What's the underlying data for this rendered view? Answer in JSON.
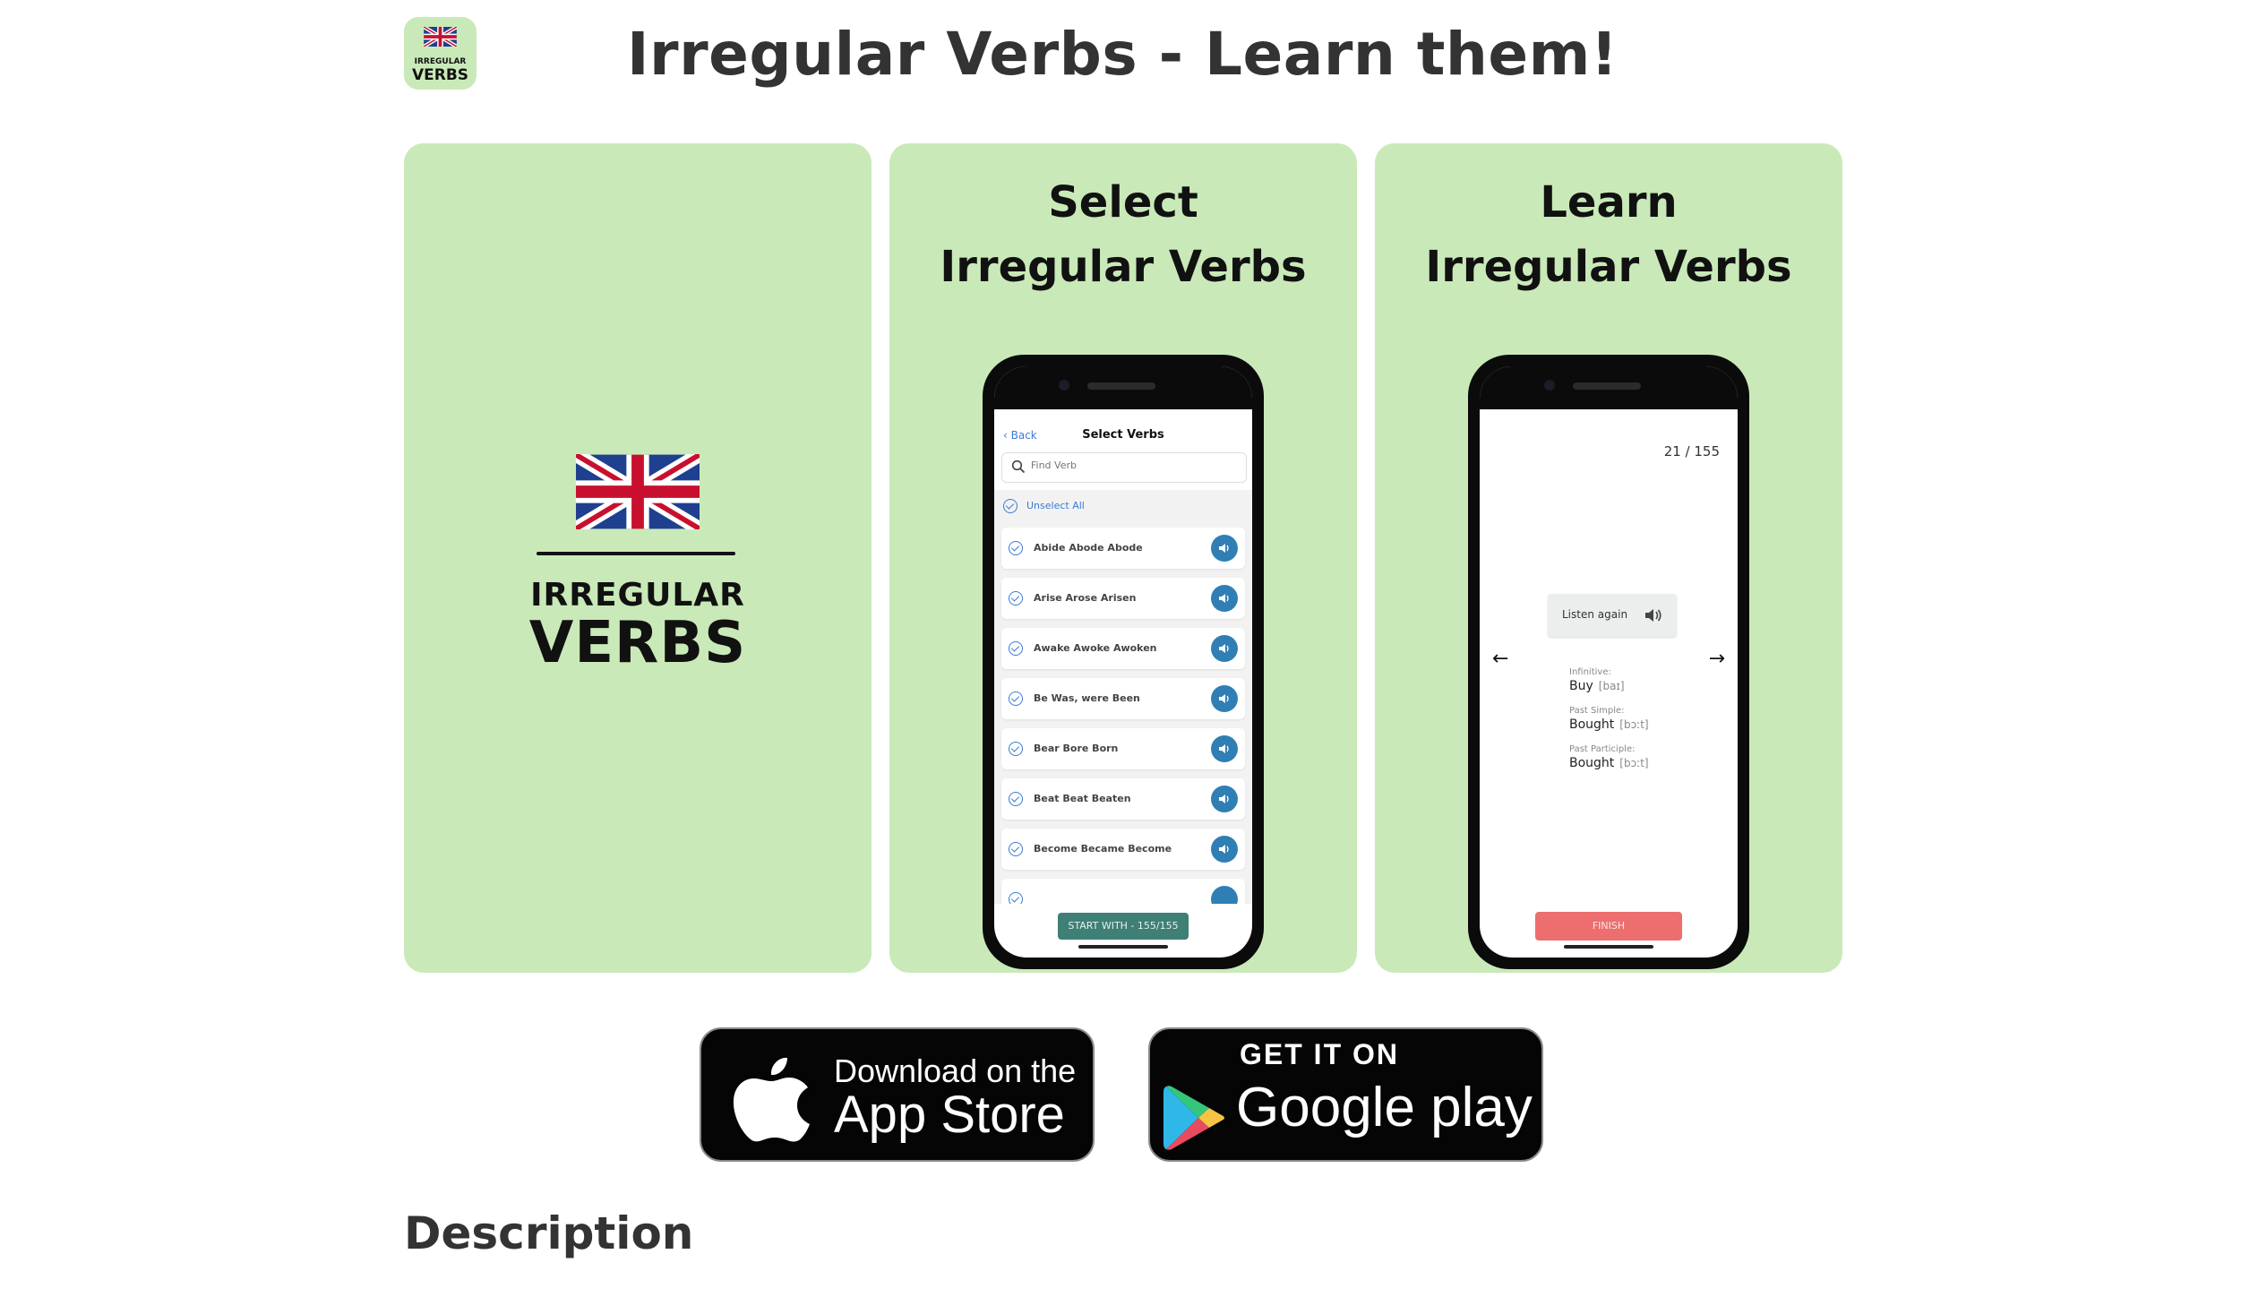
{
  "header": {
    "title": "Irregular Verbs - Learn them!",
    "app_icon": {
      "line1": "IRREGULAR",
      "line2": "VERBS"
    }
  },
  "screenshots": {
    "card1": {
      "logo_line1": "IRREGULAR",
      "logo_line2": "VERBS"
    },
    "card2": {
      "heading_line1": "Select",
      "heading_line2": "Irregular Verbs",
      "nav_back": "Back",
      "nav_title": "Select Verbs",
      "search_placeholder": "Find Verb",
      "unselect_all": "Unselect All",
      "verbs": [
        "Abide  Abode  Abode",
        "Arise  Arose  Arisen",
        "Awake  Awoke  Awoken",
        "Be  Was, were  Been",
        "Bear  Bore  Born",
        "Beat  Beat  Beaten",
        "Become  Became  Become"
      ],
      "start_button": "START WITH - 155/155"
    },
    "card3": {
      "heading_line1": "Learn",
      "heading_line2": "Irregular Verbs",
      "counter": "21 / 155",
      "listen_again": "Listen again",
      "infinitive_label": "Infinitive:",
      "infinitive_value": "Buy",
      "infinitive_ipa": "[baɪ]",
      "past_simple_label": "Past Simple:",
      "past_simple_value": "Bought",
      "past_simple_ipa": "[bɔːt]",
      "past_participle_label": "Past Participle:",
      "past_participle_value": "Bought",
      "past_participle_ipa": "[bɔːt]",
      "finish_button": "FINISH"
    }
  },
  "store_badges": {
    "apple": {
      "line1": "Download on the",
      "line2": "App Store"
    },
    "google": {
      "line1": "GET IT ON",
      "line2": "Google play"
    }
  },
  "description_heading": "Description",
  "colors": {
    "card_background": "#c9eab8",
    "start_button": "#3e7f76",
    "finish_button": "#ec6e6e",
    "link_blue": "#3a7bd5",
    "sound_button": "#2f7fb5"
  }
}
